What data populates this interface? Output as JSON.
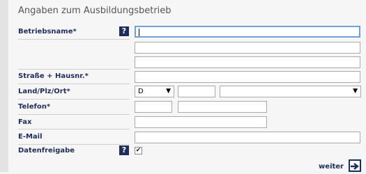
{
  "section_title": "Angaben zum Ausbildungsbetrieb",
  "labels": {
    "betriebsname": "Betriebsname*",
    "strasse": "Straße + Hausnr.*",
    "land_plz_ort": "Land/Plz/Ort*",
    "telefon": "Telefon*",
    "fax": "Fax",
    "email": "E-Mail",
    "datenfreigabe": "Datenfreigabe"
  },
  "help_icon_text": "?",
  "fields": {
    "betriebsname_1": "",
    "betriebsname_2": "",
    "betriebsname_3": "",
    "strasse": "",
    "land_selected": "D",
    "plz": "",
    "ort_selected": "",
    "telefon_vorwahl": "",
    "telefon_nummer": "",
    "fax": "",
    "email": ""
  },
  "datenfreigabe_checked": true,
  "checkbox_glyph": "✔",
  "dropdown_glyph": "▼",
  "next_button_label": "weiter",
  "colors": {
    "label": "#1f2d5a",
    "focus_border": "#6fa0d8"
  }
}
